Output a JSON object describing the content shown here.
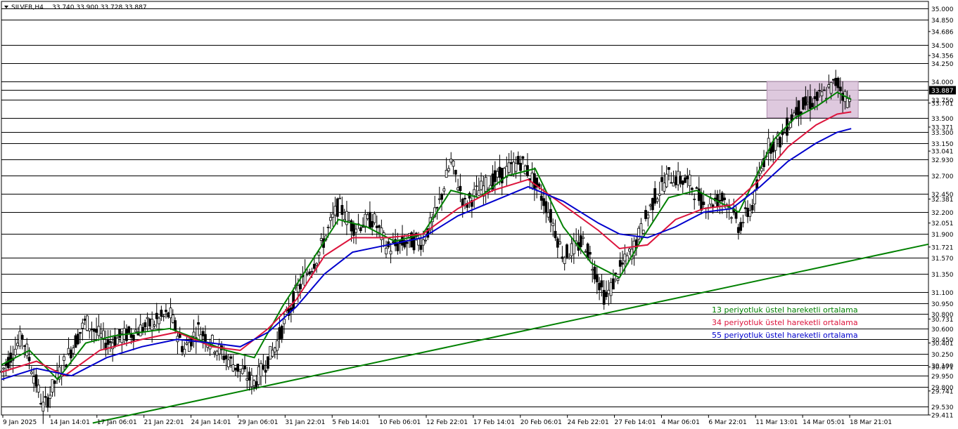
{
  "header": {
    "symbol": "SILVER,H4",
    "ohlc": "33.740 33.900 33.728 33.887"
  },
  "chart_data": {
    "type": "line",
    "subtype": "candlestick-style price chart with moving averages",
    "symbol": "SILVER,H4",
    "ylim": [
      29.411,
      35.1
    ],
    "x_tick_labels": [
      "9 Jan 2025",
      "14 Jan 14:01",
      "17 Jan 06:01",
      "21 Jan 22:01",
      "24 Jan 14:01",
      "29 Jan 06:01",
      "31 Jan 22:01",
      "5 Feb 14:01",
      "10 Feb 06:01",
      "12 Feb 22:01",
      "17 Feb 14:01",
      "20 Feb 06:01",
      "24 Feb 22:01",
      "27 Feb 14:01",
      "4 Mar 06:01",
      "6 Mar 22:01",
      "11 Mar 13:01",
      "14 Mar 05:01",
      "18 Mar 21:01"
    ],
    "y_tick_labels_minor": [
      "34.686",
      "34.356",
      "33.701",
      "33.371",
      "33.041",
      "32.381",
      "32.051",
      "31.721",
      "30.731",
      "30.401",
      "30.071",
      "29.741",
      "29.411"
    ],
    "horizontal_levels": [
      35.0,
      34.85,
      34.5,
      34.25,
      34.0,
      33.887,
      33.75,
      33.5,
      33.3,
      33.15,
      32.93,
      32.7,
      32.45,
      32.2,
      31.9,
      31.57,
      31.35,
      31.1,
      30.95,
      30.8,
      30.6,
      30.45,
      30.25,
      30.1,
      29.95,
      29.8,
      29.53
    ],
    "level_labels": [
      "35.000",
      "34.850",
      "34.500",
      "34.250",
      "34.000",
      "33.887",
      "33.750",
      "33.500",
      "33.300",
      "33.150",
      "32.930",
      "32.700",
      "32.450",
      "32.200",
      "31.900",
      "31.570",
      "31.350",
      "31.100",
      "30.950",
      "30.800",
      "30.600",
      "30.450",
      "30.250",
      "30.100",
      "29.950",
      "29.800",
      "29.530"
    ],
    "price_path": [
      [
        0,
        30.0
      ],
      [
        3,
        30.5
      ],
      [
        6,
        29.5
      ],
      [
        8,
        29.95
      ],
      [
        12,
        30.7
      ],
      [
        15,
        30.4
      ],
      [
        20,
        30.6
      ],
      [
        24,
        30.8
      ],
      [
        26,
        30.3
      ],
      [
        28,
        30.6
      ],
      [
        32,
        30.2
      ],
      [
        36,
        29.85
      ],
      [
        39,
        30.35
      ],
      [
        42,
        31.1
      ],
      [
        45,
        31.6
      ],
      [
        48,
        32.3
      ],
      [
        50,
        32.0
      ],
      [
        53,
        32.1
      ],
      [
        55,
        31.7
      ],
      [
        58,
        31.8
      ],
      [
        60,
        31.8
      ],
      [
        62,
        32.2
      ],
      [
        64,
        32.9
      ],
      [
        66,
        32.3
      ],
      [
        68,
        32.5
      ],
      [
        71,
        32.7
      ],
      [
        74,
        32.9
      ],
      [
        76,
        32.6
      ],
      [
        78,
        32.2
      ],
      [
        80,
        31.6
      ],
      [
        83,
        31.8
      ],
      [
        86,
        31.0
      ],
      [
        88,
        31.4
      ],
      [
        90,
        31.7
      ],
      [
        93,
        32.4
      ],
      [
        95,
        32.7
      ],
      [
        98,
        32.6
      ],
      [
        100,
        32.3
      ],
      [
        103,
        32.4
      ],
      [
        105,
        32.0
      ],
      [
        107,
        32.3
      ],
      [
        109,
        33.1
      ],
      [
        111,
        33.2
      ],
      [
        113,
        33.6
      ],
      [
        115,
        33.7
      ],
      [
        117,
        33.8
      ],
      [
        119,
        34.0
      ],
      [
        120,
        33.8
      ],
      [
        121,
        33.7
      ]
    ],
    "series": [
      {
        "name": "13 periyotluk üstel hareketli ortalama",
        "color": "#008000",
        "values": [
          [
            0,
            30.1
          ],
          [
            4,
            30.3
          ],
          [
            8,
            29.9
          ],
          [
            12,
            30.4
          ],
          [
            16,
            30.5
          ],
          [
            20,
            30.55
          ],
          [
            24,
            30.6
          ],
          [
            28,
            30.45
          ],
          [
            32,
            30.3
          ],
          [
            36,
            30.2
          ],
          [
            40,
            30.9
          ],
          [
            44,
            31.5
          ],
          [
            48,
            32.1
          ],
          [
            52,
            32.0
          ],
          [
            56,
            31.8
          ],
          [
            60,
            31.9
          ],
          [
            64,
            32.5
          ],
          [
            68,
            32.4
          ],
          [
            72,
            32.7
          ],
          [
            76,
            32.8
          ],
          [
            80,
            32.0
          ],
          [
            84,
            31.5
          ],
          [
            88,
            31.3
          ],
          [
            91,
            31.8
          ],
          [
            95,
            32.4
          ],
          [
            99,
            32.5
          ],
          [
            103,
            32.3
          ],
          [
            105,
            32.2
          ],
          [
            107,
            32.6
          ],
          [
            110,
            33.2
          ],
          [
            113,
            33.5
          ],
          [
            116,
            33.65
          ],
          [
            119,
            33.85
          ],
          [
            121,
            33.75
          ]
        ]
      },
      {
        "name": "34 periyotluk üstel hareketli ortalama",
        "color": "#dc143c",
        "values": [
          [
            0,
            30.0
          ],
          [
            5,
            30.15
          ],
          [
            9,
            29.95
          ],
          [
            14,
            30.3
          ],
          [
            20,
            30.45
          ],
          [
            25,
            30.55
          ],
          [
            30,
            30.35
          ],
          [
            34,
            30.3
          ],
          [
            38,
            30.6
          ],
          [
            42,
            31.0
          ],
          [
            46,
            31.6
          ],
          [
            50,
            31.85
          ],
          [
            55,
            31.85
          ],
          [
            60,
            31.9
          ],
          [
            65,
            32.25
          ],
          [
            70,
            32.5
          ],
          [
            75,
            32.65
          ],
          [
            80,
            32.3
          ],
          [
            85,
            31.95
          ],
          [
            88,
            31.7
          ],
          [
            92,
            31.75
          ],
          [
            96,
            32.1
          ],
          [
            100,
            32.25
          ],
          [
            104,
            32.3
          ],
          [
            108,
            32.65
          ],
          [
            112,
            33.1
          ],
          [
            116,
            33.4
          ],
          [
            119,
            33.55
          ],
          [
            121,
            33.58
          ]
        ]
      },
      {
        "name": "55 periyotluk üstel hareketli ortalama",
        "color": "#0000cd",
        "values": [
          [
            0,
            29.9
          ],
          [
            5,
            30.05
          ],
          [
            10,
            29.95
          ],
          [
            15,
            30.2
          ],
          [
            20,
            30.35
          ],
          [
            25,
            30.45
          ],
          [
            30,
            30.4
          ],
          [
            34,
            30.35
          ],
          [
            38,
            30.55
          ],
          [
            42,
            30.9
          ],
          [
            46,
            31.35
          ],
          [
            50,
            31.65
          ],
          [
            55,
            31.75
          ],
          [
            60,
            31.85
          ],
          [
            65,
            32.15
          ],
          [
            70,
            32.35
          ],
          [
            75,
            32.55
          ],
          [
            80,
            32.35
          ],
          [
            85,
            32.05
          ],
          [
            88,
            31.9
          ],
          [
            92,
            31.85
          ],
          [
            96,
            32.0
          ],
          [
            100,
            32.2
          ],
          [
            104,
            32.25
          ],
          [
            108,
            32.55
          ],
          [
            112,
            32.9
          ],
          [
            116,
            33.15
          ],
          [
            119,
            33.3
          ],
          [
            121,
            33.35
          ]
        ]
      }
    ],
    "trendline": {
      "color": "#008000",
      "from": [
        13,
        29.3
      ],
      "to": [
        132,
        31.76
      ]
    },
    "box": {
      "x": [
        109,
        122
      ],
      "y": [
        33.5,
        34.0
      ],
      "color": "#d8bfd8"
    },
    "x_range": [
      0,
      132
    ],
    "legend": [
      "13 periyotluk üstel hareketli ortalama",
      "34 periyotluk üstel hareketli ortalama",
      "55 periyotluk üstel hareketli ortalama"
    ],
    "legend_placement": "bottom-right"
  }
}
